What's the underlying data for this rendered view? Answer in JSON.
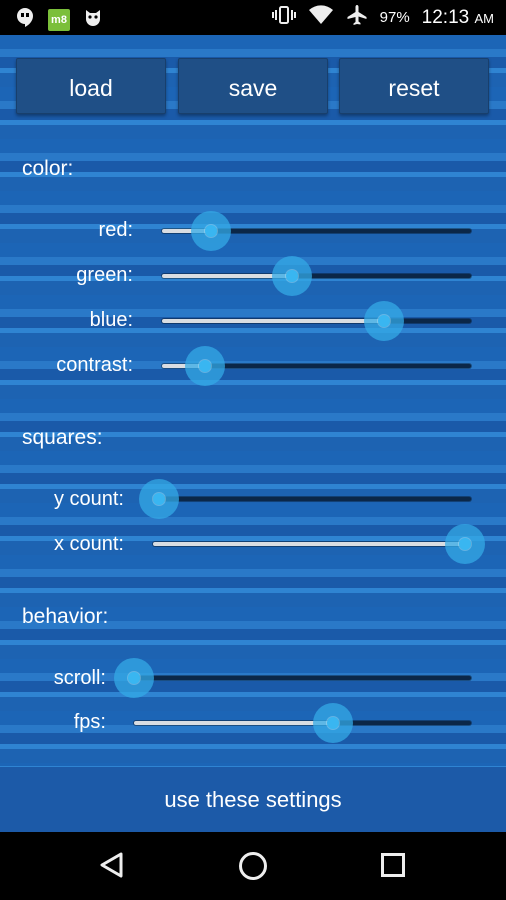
{
  "status_bar": {
    "left_icons": [
      "hangouts-icon",
      "m8-app-icon",
      "cat-app-icon"
    ],
    "m8_label": "m8",
    "right_icons": [
      "vibrate-icon",
      "wifi-icon",
      "airplane-icon"
    ],
    "battery": "97%",
    "time": "12:13",
    "ampm": "AM"
  },
  "toolbar": {
    "load_label": "load",
    "save_label": "save",
    "reset_label": "reset"
  },
  "sections": {
    "color": {
      "title": "color:",
      "sliders": [
        {
          "label": "red:",
          "value": 0.16
        },
        {
          "label": "green:",
          "value": 0.42
        },
        {
          "label": "blue:",
          "value": 0.72
        },
        {
          "label": "contrast:",
          "value": 0.14
        }
      ]
    },
    "squares": {
      "title": "squares:",
      "sliders": [
        {
          "label": "y count:",
          "value": 0.02
        },
        {
          "label": "x count:",
          "value": 0.98
        }
      ]
    },
    "behavior": {
      "title": "behavior:",
      "sliders": [
        {
          "label": "scroll:",
          "value": 0.0
        },
        {
          "label": "fps:",
          "value": 0.59
        }
      ]
    }
  },
  "footer": {
    "use_label": "use these settings"
  },
  "nav": {
    "icons": [
      "back-icon",
      "home-icon",
      "recents-icon"
    ]
  },
  "colors": {
    "accent": "#39b6f1",
    "button_bg": "#1f4f86",
    "stripe_base": "#1c65b6"
  }
}
